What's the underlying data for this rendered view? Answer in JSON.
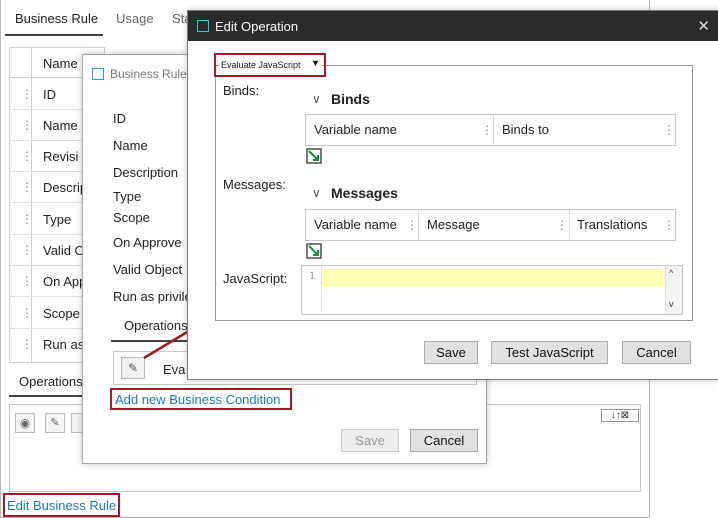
{
  "bg": {
    "tabs": [
      "Business Rule",
      "Usage",
      "Sta"
    ],
    "grid_header": "Name",
    "rows": [
      "ID",
      "Name",
      "Revisi",
      "Descrip",
      "Type",
      "Valid O",
      "On App",
      "Scope",
      "Run as"
    ],
    "operations_label": "Operations",
    "edit_link": "Edit Business Rule",
    "toolbar_arrows": "↓↑⊠"
  },
  "mid": {
    "title": "Business Rule E",
    "labels": [
      "ID",
      "Name",
      "Description",
      "Type",
      "Scope",
      "On Approve",
      "Valid Object",
      "Run as privile"
    ],
    "operations_tab": "Operations",
    "operation_row": "Eva",
    "add_link": "Add new Business Condition",
    "save": "Save",
    "cancel": "Cancel"
  },
  "front": {
    "title": "Edit Operation",
    "close": "✕",
    "dropdown_value": "Evaluate JavaScript",
    "binds_label": "Binds:",
    "binds_title": "Binds",
    "binds_cols": [
      "Variable name",
      "Binds to"
    ],
    "messages_label": "Messages:",
    "messages_title": "Messages",
    "messages_cols": [
      "Variable name",
      "Message",
      "Translations"
    ],
    "js_label": "JavaScript:",
    "line_no": "1",
    "save": "Save",
    "test": "Test JavaScript",
    "cancel": "Cancel"
  },
  "colors": {
    "accent": "#2aa3b5",
    "highlight": "#9e1c25",
    "link": "#1a7bb9",
    "titlebar": "#2b2b2b",
    "editor_line": "#ffffb3"
  }
}
